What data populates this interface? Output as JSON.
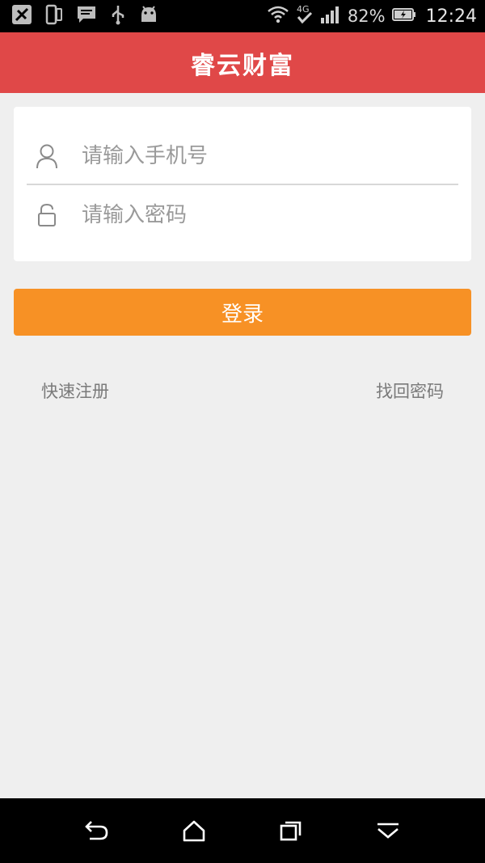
{
  "status_bar": {
    "battery_percent": "82%",
    "time": "12:24",
    "network": "4G",
    "icons_left": [
      "no-signal-icon",
      "phone-icon",
      "message-icon",
      "usb-icon",
      "android-icon"
    ],
    "icons_right": [
      "wifi-icon",
      "network-4g-icon",
      "signal-icon",
      "battery-icon"
    ]
  },
  "header": {
    "title": "睿云财富",
    "color": "#e04848"
  },
  "login_form": {
    "phone_placeholder": "请输入手机号",
    "phone_value": "",
    "password_placeholder": "请输入密码",
    "password_value": "",
    "phone_icon": "user-icon",
    "password_icon": "lock-icon"
  },
  "login_button": {
    "label": "登录",
    "color": "#f79125"
  },
  "links": {
    "register": "快速注册",
    "recover_password": "找回密码"
  },
  "nav_bar": {
    "icons": [
      "back-icon",
      "home-icon",
      "recent-apps-icon",
      "collapse-icon"
    ]
  }
}
